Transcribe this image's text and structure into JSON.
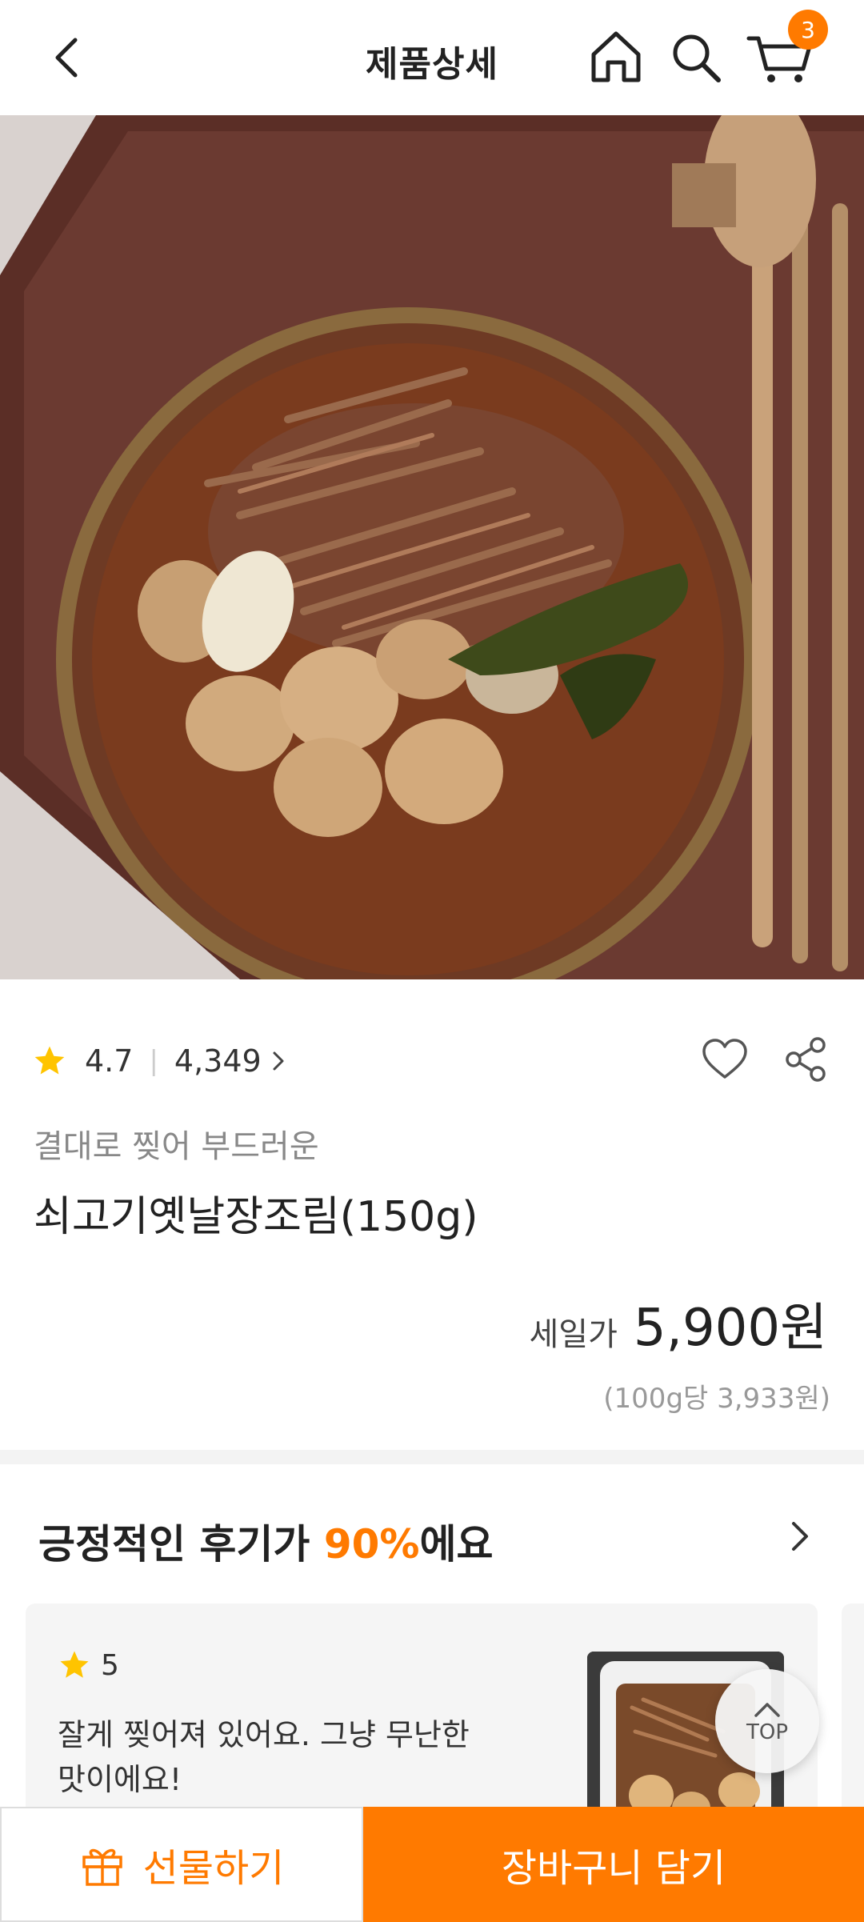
{
  "header": {
    "title": "제품상세",
    "cart_count": "3"
  },
  "product": {
    "rating": "4.7",
    "review_count": "4,349",
    "subtitle": "결대로 찢어 부드러운",
    "name": "쇠고기옛날장조림(150g)",
    "price_label": "세일가",
    "price": "5,900원",
    "unit_price": "(100g당 3,933원)"
  },
  "reviews": {
    "heading_prefix": "긍정적인 후기가 ",
    "heading_percent": "90%",
    "heading_suffix": "에요",
    "items": [
      {
        "stars": "5",
        "text": "잘게 찢어져 있어요. 그냥 무난한 맛이에요!"
      }
    ]
  },
  "top_button": {
    "label": "TOP"
  },
  "bottom_bar": {
    "gift_label": "선물하기",
    "add_to_cart_label": "장바구니 담기"
  },
  "colors": {
    "accent": "#ff7a00",
    "star": "#ffc400"
  }
}
